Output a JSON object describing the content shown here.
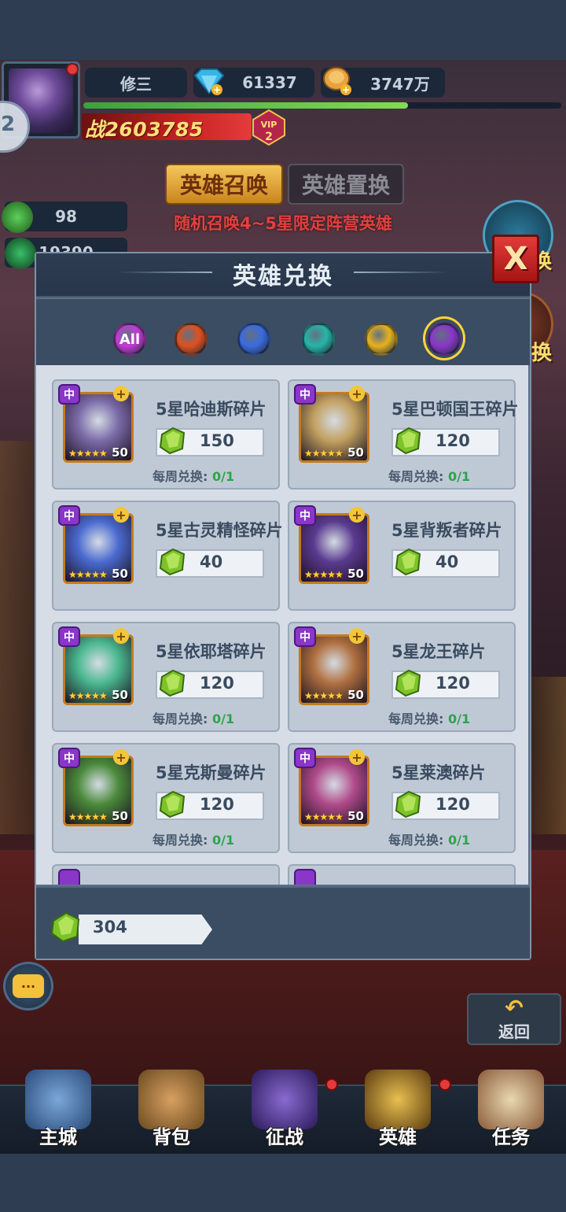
{
  "player": {
    "name": "修三",
    "gems": "61337",
    "gold": "3747万",
    "power_label": "战",
    "power": "2603785",
    "vip_label": "VIP",
    "vip_level": "2",
    "exp_progress": 0.68,
    "side_tab_number": "2"
  },
  "summon_tabs": {
    "summon_label": "英雄召唤",
    "swap_label": "英雄置换",
    "description": "随机召唤4~5星限定阵营英雄"
  },
  "resources": [
    {
      "icon": "green-crystal-icon",
      "value": "98"
    },
    {
      "icon": "green-orb-icon",
      "value": "19390"
    }
  ],
  "right_buttons": [
    "换",
    "换"
  ],
  "modal": {
    "title": "英雄兑换",
    "close_label": "X",
    "factions": [
      {
        "icon": "all-factions-icon",
        "label": "All",
        "color": "#c43ad6"
      },
      {
        "icon": "fire-faction-icon",
        "label": "",
        "color": "#e2501e"
      },
      {
        "icon": "holy-faction-icon",
        "label": "",
        "color": "#3a6be0"
      },
      {
        "icon": "skull-faction-icon",
        "label": "",
        "color": "#25b6a8"
      },
      {
        "icon": "wing-faction-icon",
        "label": "",
        "color": "#e8b21c"
      },
      {
        "icon": "demon-faction-icon",
        "label": "",
        "color": "#8a36c8",
        "selected": true
      }
    ],
    "limit_label": "每周兑换:",
    "items": [
      {
        "name": "5星哈迪斯碎片",
        "price": "150",
        "limit": "0/1",
        "level": "50",
        "faction": "中",
        "art": "#7a6aa8",
        "show_limit": true
      },
      {
        "name": "5星巴顿国王碎片",
        "price": "120",
        "limit": "0/1",
        "level": "50",
        "faction": "中",
        "art": "#c2a060",
        "show_limit": true
      },
      {
        "name": "5星古灵精怪碎片",
        "price": "40",
        "limit": "",
        "level": "50",
        "faction": "中",
        "art": "#4a6ad0",
        "show_limit": false
      },
      {
        "name": "5星背叛者碎片",
        "price": "40",
        "limit": "",
        "level": "50",
        "faction": "中",
        "art": "#5a3a90",
        "show_limit": false
      },
      {
        "name": "5星依耶塔碎片",
        "price": "120",
        "limit": "0/1",
        "level": "50",
        "faction": "中",
        "art": "#4ab890",
        "show_limit": true
      },
      {
        "name": "5星龙王碎片",
        "price": "120",
        "limit": "0/1",
        "level": "50",
        "faction": "中",
        "art": "#b07040",
        "show_limit": true
      },
      {
        "name": "5星克斯曼碎片",
        "price": "120",
        "limit": "0/1",
        "level": "50",
        "faction": "中",
        "art": "#4a8a3a",
        "show_limit": true
      },
      {
        "name": "5星莱澳碎片",
        "price": "120",
        "limit": "0/1",
        "level": "50",
        "faction": "中",
        "art": "#b04a8a",
        "show_limit": true
      }
    ],
    "balance": "304"
  },
  "chat_label": "···",
  "back_label": "返回",
  "bottom_nav": [
    {
      "label": "主城",
      "icon": "castle-icon",
      "dot": false
    },
    {
      "label": "背包",
      "icon": "backpack-icon",
      "dot": false
    },
    {
      "label": "征战",
      "icon": "battle-portal-icon",
      "dot": true
    },
    {
      "label": "英雄",
      "icon": "hero-helmet-icon",
      "dot": true
    },
    {
      "label": "任务",
      "icon": "quest-scroll-icon",
      "dot": false
    }
  ]
}
